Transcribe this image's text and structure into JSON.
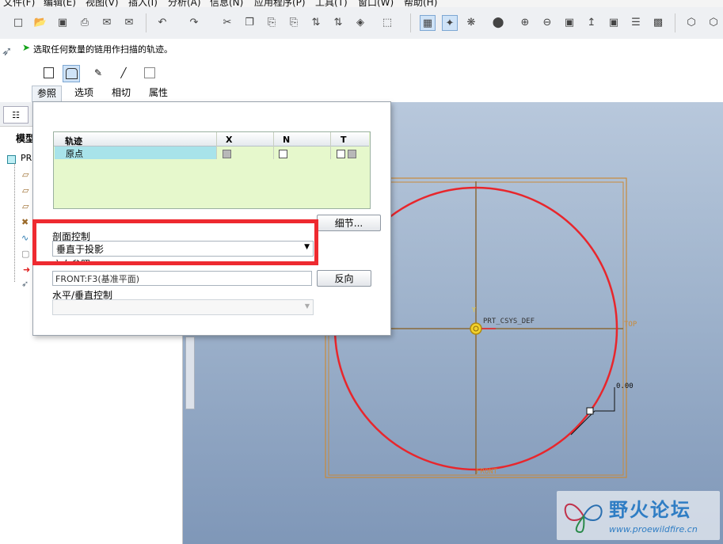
{
  "menubar": {
    "items": [
      "文件(F)",
      "编辑(E)",
      "视图(V)",
      "插入(I)",
      "分析(A)",
      "信息(N)",
      "应用程序(P)",
      "工具(T)",
      "窗口(W)",
      "帮助(H)"
    ]
  },
  "prompt": {
    "text": "选取任何数量的链用作扫描的轨迹。"
  },
  "dashboard": {
    "tabs": [
      {
        "label": "参照",
        "active": true
      },
      {
        "label": "选项",
        "active": false
      },
      {
        "label": "相切",
        "active": false
      },
      {
        "label": "属性",
        "active": false
      }
    ]
  },
  "left_panel": {
    "title": "模型",
    "root": "PR"
  },
  "references_panel": {
    "trajectories": {
      "columns": [
        "轨迹",
        "X",
        "N",
        "T"
      ],
      "rows": [
        {
          "name": "原点",
          "x": true,
          "n": false,
          "t": [
            false,
            true
          ]
        }
      ]
    },
    "details_button": "细节...",
    "section_control": {
      "label": "剖面控制",
      "value": "垂直于投影"
    },
    "direction_reference": {
      "label": "方向参照",
      "value": "FRONT:F3(基准平面)",
      "flip_button": "反向"
    },
    "horizontal_vertical": {
      "label": "水平/垂直控制",
      "value": ""
    }
  },
  "viewport": {
    "csys_label": "PRT_CSYS_DEF",
    "plane_top": "TOP",
    "plane_front": "FRONT",
    "axis_y": "Y",
    "dimension": "0.00",
    "curve_color": "#e8262c",
    "plane_color": "#c98a3a"
  },
  "watermark": {
    "title": "野火论坛",
    "url": "www.proewildfire.cn"
  },
  "colors": {
    "highlight": "#ee2a30",
    "table_bg": "#e6f8cc",
    "row_selected": "#a8e3ea"
  }
}
